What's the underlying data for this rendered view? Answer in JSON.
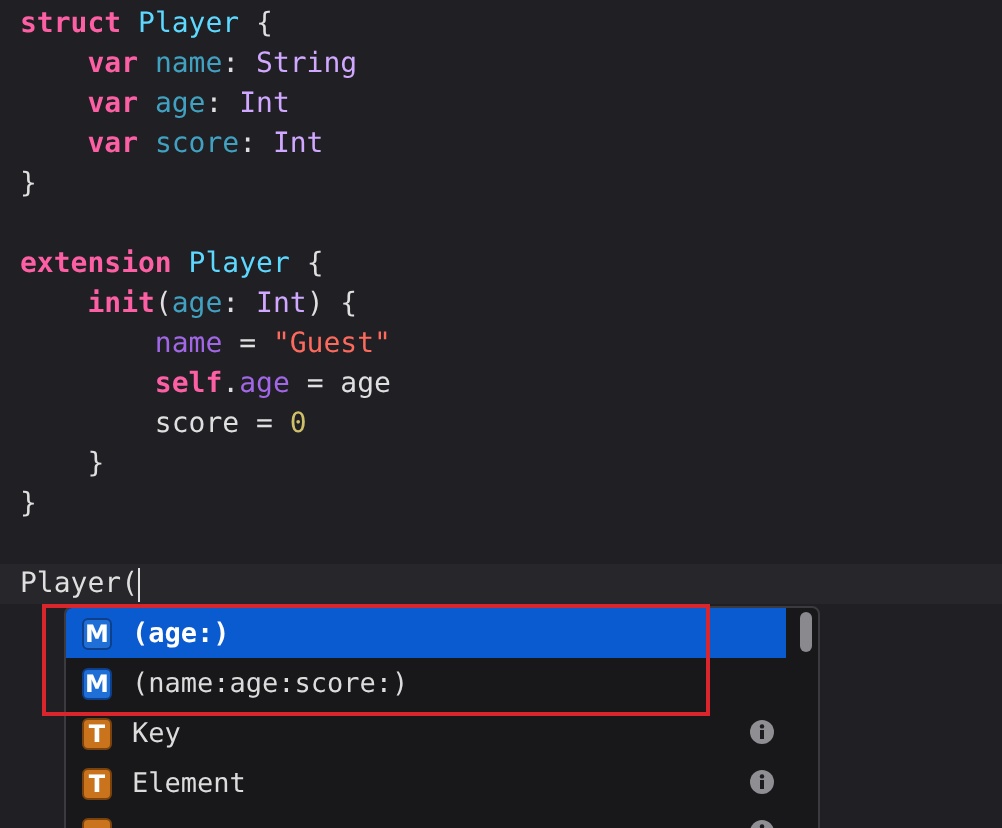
{
  "editor": {
    "lines": [
      {
        "kind": "code",
        "current": false,
        "tokens": [
          {
            "text": "struct ",
            "kind": "keyword"
          },
          {
            "text": "Player ",
            "kind": "type"
          },
          {
            "text": "{",
            "kind": "plain"
          }
        ]
      },
      {
        "kind": "code",
        "current": false,
        "tokens": [
          {
            "text": "    var ",
            "kind": "keyword"
          },
          {
            "text": "name",
            "kind": "decl"
          },
          {
            "text": ": ",
            "kind": "plain"
          },
          {
            "text": "String",
            "kind": "builtin"
          }
        ]
      },
      {
        "kind": "code",
        "current": false,
        "tokens": [
          {
            "text": "    var ",
            "kind": "keyword"
          },
          {
            "text": "age",
            "kind": "decl"
          },
          {
            "text": ": ",
            "kind": "plain"
          },
          {
            "text": "Int",
            "kind": "builtin"
          }
        ]
      },
      {
        "kind": "code",
        "current": false,
        "tokens": [
          {
            "text": "    var ",
            "kind": "keyword"
          },
          {
            "text": "score",
            "kind": "decl"
          },
          {
            "text": ": ",
            "kind": "plain"
          },
          {
            "text": "Int",
            "kind": "builtin"
          }
        ]
      },
      {
        "kind": "code",
        "current": false,
        "tokens": [
          {
            "text": "}",
            "kind": "plain"
          }
        ]
      },
      {
        "kind": "blank",
        "current": false
      },
      {
        "kind": "code",
        "current": false,
        "tokens": [
          {
            "text": "extension ",
            "kind": "keyword"
          },
          {
            "text": "Player ",
            "kind": "type"
          },
          {
            "text": "{",
            "kind": "plain"
          }
        ]
      },
      {
        "kind": "code",
        "current": false,
        "tokens": [
          {
            "text": "    init",
            "kind": "keyword"
          },
          {
            "text": "(",
            "kind": "plain"
          },
          {
            "text": "age",
            "kind": "decl"
          },
          {
            "text": ": ",
            "kind": "plain"
          },
          {
            "text": "Int",
            "kind": "builtin"
          },
          {
            "text": ") {",
            "kind": "plain"
          }
        ]
      },
      {
        "kind": "code",
        "current": false,
        "tokens": [
          {
            "text": "        name",
            "kind": "member"
          },
          {
            "text": " = ",
            "kind": "plain"
          },
          {
            "text": "\"Guest\"",
            "kind": "string"
          }
        ]
      },
      {
        "kind": "code",
        "current": false,
        "tokens": [
          {
            "text": "        self",
            "kind": "keyword"
          },
          {
            "text": ".",
            "kind": "plain"
          },
          {
            "text": "age",
            "kind": "member"
          },
          {
            "text": " = age",
            "kind": "plain"
          }
        ]
      },
      {
        "kind": "code",
        "current": false,
        "tokens": [
          {
            "text": "        score = ",
            "kind": "plain"
          },
          {
            "text": "0",
            "kind": "number"
          }
        ]
      },
      {
        "kind": "code",
        "current": false,
        "tokens": [
          {
            "text": "    }",
            "kind": "plain"
          }
        ]
      },
      {
        "kind": "code",
        "current": false,
        "tokens": [
          {
            "text": "}",
            "kind": "plain"
          }
        ]
      },
      {
        "kind": "blank",
        "current": false
      },
      {
        "kind": "code",
        "current": true,
        "tokens": [
          {
            "text": "Player(",
            "kind": "plain"
          }
        ]
      }
    ]
  },
  "completion": {
    "items": [
      {
        "kind": "method",
        "badge": "M",
        "label": "(age:)",
        "selected": true,
        "info": false
      },
      {
        "kind": "method",
        "badge": "M",
        "label": "(name:age:score:)",
        "selected": false,
        "info": false
      },
      {
        "kind": "type",
        "badge": "T",
        "label": "Key",
        "selected": false,
        "info": true
      },
      {
        "kind": "type",
        "badge": "T",
        "label": "Element",
        "selected": false,
        "info": true
      },
      {
        "kind": "type",
        "selected": false,
        "info": true
      }
    ]
  }
}
